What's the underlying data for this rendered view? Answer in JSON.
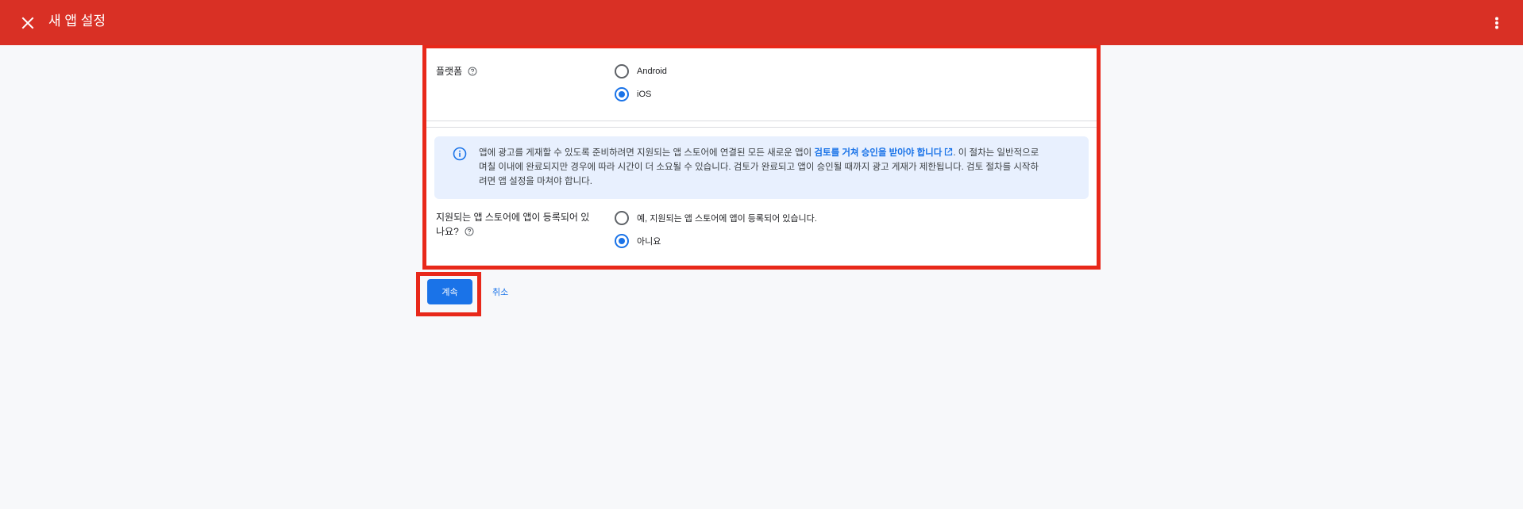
{
  "header": {
    "title": "새 앱 설정",
    "close_icon": "close-icon",
    "more_icon": "more-vertical-icon",
    "background_color": "#d93025"
  },
  "platform": {
    "label": "플랫폼",
    "help_icon": "help-icon",
    "options": [
      {
        "label": "Android",
        "checked": false
      },
      {
        "label": "iOS",
        "checked": true
      }
    ]
  },
  "info": {
    "icon": "info-icon",
    "text_before": "앱에 광고를 게재할 수 있도록 준비하려면 지원되는 앱 스토어에 연결된 모든 새로운 앱이 ",
    "link": "검토를 거쳐 승인을 받아야 합니다",
    "link_icon": "external-link-icon",
    "text_after_line1": ". 이 절차는 일반적으로",
    "line2": "며칠 이내에 완료되지만 경우에 따라 시간이 더 소요될 수 있습니다. 검토가 완료되고 앱이 승인될 때까지 광고 게재가 제한됩니다. 검토 절차를 시작하",
    "line3": "려면 앱 설정을 마쳐야 합니다."
  },
  "store": {
    "label_line1": "지원되는 앱 스토어에 앱이 등록되어 있",
    "label_line2": "나요?",
    "help_icon": "help-icon",
    "options": [
      {
        "label": "예, 지원되는 앱 스토어에 앱이 등록되어 있습니다.",
        "checked": false
      },
      {
        "label": "아니요",
        "checked": true
      }
    ]
  },
  "actions": {
    "continue_label": "계속",
    "cancel_label": "취소"
  },
  "colors": {
    "accent": "#1a73e8",
    "highlight": "#e8281a",
    "info_bg": "#e8f0fe"
  }
}
